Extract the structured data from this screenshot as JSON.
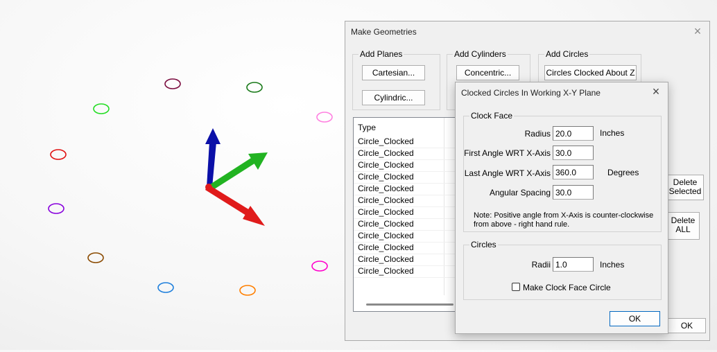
{
  "viewport": {
    "axes": {
      "x_color": "#e01b1b",
      "y_color": "#22b322",
      "z_color": "#0b10a8"
    },
    "circle_colors": [
      "#7a0b3e",
      "#1a7a1a",
      "#ff80e0",
      "#ff00cc",
      "#ff7f00",
      "#1e7fdc",
      "#8a4a00",
      "#8800dd",
      "#e01010",
      "#22dd22"
    ]
  },
  "make_geometries": {
    "title": "Make Geometries",
    "close_icon": "×",
    "add_planes": {
      "label": "Add Planes",
      "cartesian": "Cartesian...",
      "cylindric": "Cylindric..."
    },
    "add_cylinders": {
      "label": "Add Cylinders",
      "concentric": "Concentric..."
    },
    "add_circles": {
      "label": "Add Circles",
      "clocked_about_z": "Circles Clocked About Z"
    },
    "list": {
      "header": "Type",
      "rows": [
        "Circle_Clocked",
        "Circle_Clocked",
        "Circle_Clocked",
        "Circle_Clocked",
        "Circle_Clocked",
        "Circle_Clocked",
        "Circle_Clocked",
        "Circle_Clocked",
        "Circle_Clocked",
        "Circle_Clocked",
        "Circle_Clocked",
        "Circle_Clocked"
      ]
    },
    "delete_selected": "Delete\nSelected",
    "delete_all": "Delete\nALL",
    "ok": "OK"
  },
  "clocked_dialog": {
    "title": "Clocked Circles In Working X-Y Plane",
    "close_icon": "×",
    "clock_face": {
      "label": "Clock Face",
      "radius_label": "Radius",
      "radius_value": "20.0",
      "inches_1": "Inches",
      "first_angle_label": "First Angle WRT X-Axis",
      "first_angle_value": "30.0",
      "last_angle_label": "Last Angle WRT X-Axis",
      "last_angle_value": "360.0",
      "degrees": "Degrees",
      "spacing_label": "Angular Spacing",
      "spacing_value": "30.0",
      "note_line1": "Note: Positive angle from X-Axis is counter-clockwise",
      "note_line2": "from above - right hand rule."
    },
    "circles": {
      "label": "Circles",
      "radii_label": "Radii",
      "radii_value": "1.0",
      "inches_2": "Inches",
      "make_clock_face": "Make Clock Face Circle",
      "make_clock_face_checked": false
    },
    "ok": "OK"
  }
}
